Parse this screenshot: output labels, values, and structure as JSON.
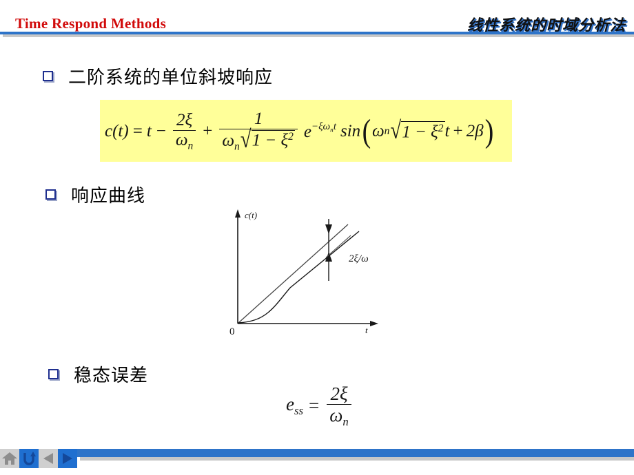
{
  "header": {
    "title_en": "Time Respond Methods",
    "title_cn": "线性系统的时域分析法",
    "title_en_color": "#d10a0a",
    "rule_color": "#2e74c9"
  },
  "bullets": [
    {
      "id": "bullet-1",
      "label": "二阶系统的单位斜坡响应"
    },
    {
      "id": "bullet-2",
      "label": "响应曲线"
    },
    {
      "id": "bullet-3",
      "label": "稳态误差"
    }
  ],
  "formula_main": {
    "highlight_color": "#ffff99",
    "lhs": "c(t)",
    "equals": "=",
    "term_t": "t",
    "minus": "−",
    "frac1_num": "2ξ",
    "frac1_den_omega": "ω",
    "frac1_den_sub": "n",
    "plus": "+",
    "frac2_num": "1",
    "frac2_den_omega": "ω",
    "frac2_den_sub": "n",
    "radical_sign": "√",
    "radical_body": "1 − ξ",
    "radical_exp": "2",
    "exp_base": "e",
    "exp_power": "−ξω",
    "exp_power_sub": "n",
    "exp_power_t": "t",
    "sin": "sin",
    "paren_open": "(",
    "inner_omega": "ω",
    "inner_omega_sub": "n",
    "inner_radical_body": "1 − ξ",
    "inner_radical_exp": "2",
    "inner_t": "t",
    "inner_plus": "+",
    "inner_beta": "2β",
    "paren_close": ")",
    "plain_text": "c(t) = t − 2ξ/ωn + 1/(ωn√(1−ξ²)) e^(−ξωn t) sin(ωn√(1−ξ²)t + 2β)"
  },
  "formula_ess": {
    "lhs": "e",
    "lhs_sub": "ss",
    "equals": "=",
    "num": "2ξ",
    "den_omega": "ω",
    "den_sub": "n",
    "plain_text": "e_ss = 2ξ/ωn"
  },
  "graph": {
    "y_axis_label": "c(t)",
    "x_axis_label": "t",
    "origin_label": "0",
    "annotation": "2ξ/ω",
    "annotation_plain": "2xi/omega",
    "series": [
      {
        "name": "unit-ramp-input",
        "description": "straight ramp line r(t)=t from origin"
      },
      {
        "name": "second-order-response",
        "description": "response c(t) rising from origin, lagging the ramp, asymptotically parallel"
      }
    ],
    "steady_state_gap_label": "2ξ/ω"
  },
  "footer": {
    "buttons": [
      {
        "name": "home",
        "icon": "home-icon",
        "bg": "#cfcfcf",
        "fg": "#8d8d8d"
      },
      {
        "name": "back",
        "icon": "return-arrow-icon",
        "bg": "#1f6fd0",
        "fg": "#14489a"
      },
      {
        "name": "prev",
        "icon": "triangle-left-icon",
        "bg": "#cfcfcf",
        "fg": "#8d8d8d"
      },
      {
        "name": "next",
        "icon": "triangle-right-icon",
        "bg": "#1f6fd0",
        "fg": "#14489a"
      }
    ],
    "bar_color": "#2e74c9"
  }
}
